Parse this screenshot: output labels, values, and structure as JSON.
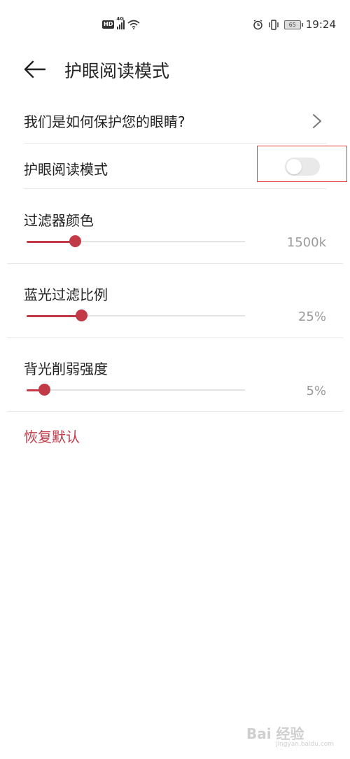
{
  "status_bar": {
    "network": "4G",
    "hd_label": "HD",
    "battery": "65",
    "time": "19:24"
  },
  "header": {
    "title": "护眼阅读模式"
  },
  "rows": {
    "how_protect": "我们是如何保护您的眼睛?",
    "mode_label": "护眼阅读模式",
    "mode_enabled": false
  },
  "sliders": [
    {
      "label": "过滤器颜色",
      "value_text": "1500k",
      "fraction": 0.22
    },
    {
      "label": "蓝光过滤比例",
      "value_text": "25%",
      "fraction": 0.25
    },
    {
      "label": "背光削弱强度",
      "value_text": "5%",
      "fraction": 0.08
    }
  ],
  "reset_label": "恢复默认",
  "colors": {
    "accent": "#c23a47",
    "highlight": "#e0393e",
    "toggle_off": "#e9e9e9"
  },
  "watermark": {
    "text": "Bai 经验",
    "sub": "jingyan.baidu.com"
  }
}
